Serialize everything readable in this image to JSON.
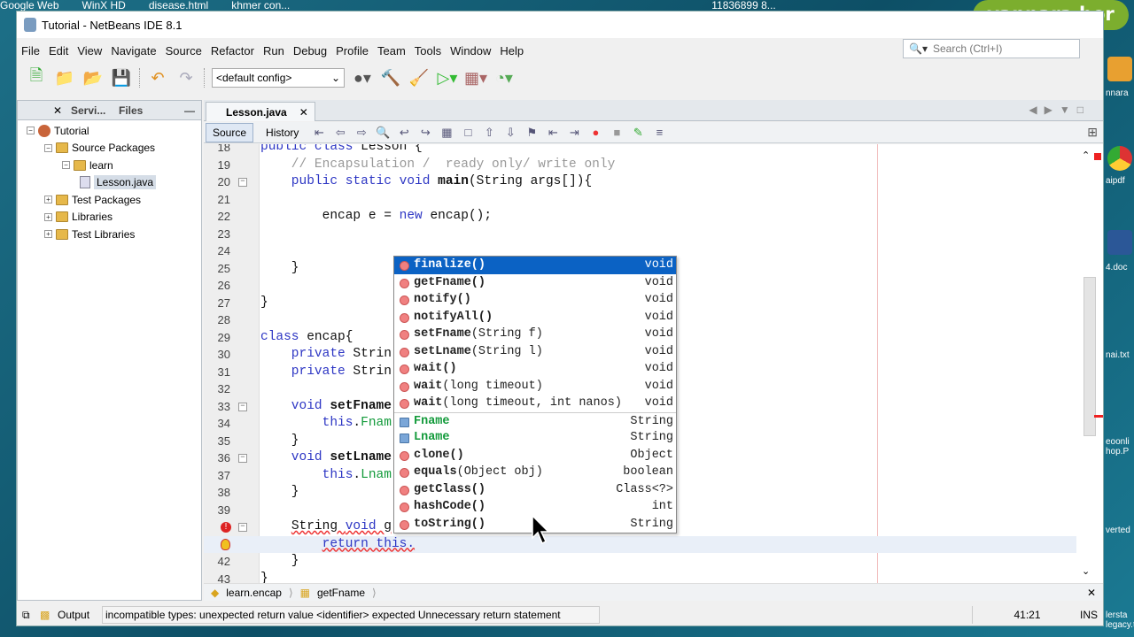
{
  "desktop": {
    "top_items": [
      "Google Web",
      "WinX HD",
      "disease.html",
      "khmer con...",
      "11836899 8..."
    ],
    "right_labels": [
      "nnara",
      "aipdf",
      "4.doc",
      "nai.txt",
      "eoonli hop.P",
      "verted",
      "lersta legacy.t"
    ],
    "badge": "vannara hor"
  },
  "window": {
    "title": "Tutorial - NetBeans IDE 8.1"
  },
  "menu": [
    "File",
    "Edit",
    "View",
    "Navigate",
    "Source",
    "Refactor",
    "Run",
    "Debug",
    "Profile",
    "Team",
    "Tools",
    "Window",
    "Help"
  ],
  "search": {
    "placeholder": "Search (Ctrl+I)"
  },
  "toolbar": {
    "config": "<default config>"
  },
  "left_panel": {
    "tabs": [
      "Servi...",
      "Files"
    ],
    "tree": [
      {
        "label": "Tutorial",
        "depth": 0,
        "type": "project"
      },
      {
        "label": "Source Packages",
        "depth": 1,
        "type": "folder"
      },
      {
        "label": "learn",
        "depth": 2,
        "type": "package"
      },
      {
        "label": "Lesson.java",
        "depth": 3,
        "type": "file",
        "selected": true
      },
      {
        "label": "Test Packages",
        "depth": 1,
        "type": "folder"
      },
      {
        "label": "Libraries",
        "depth": 1,
        "type": "folder"
      },
      {
        "label": "Test Libraries",
        "depth": 1,
        "type": "folder"
      }
    ]
  },
  "editor": {
    "tab": "Lesson.java",
    "source_label": "Source",
    "history_label": "History",
    "lines": [
      {
        "n": "18",
        "t": [
          [
            "public class ",
            "kw"
          ],
          [
            "Lesson {",
            ""
          ]
        ]
      },
      {
        "n": "19",
        "t": [
          [
            "    // Encapsulation /  ready only/ write only",
            "cm"
          ]
        ]
      },
      {
        "n": "20",
        "fold": true,
        "t": [
          [
            "    public static void ",
            "kw"
          ],
          [
            "main",
            "bd"
          ],
          [
            "(String args[]){",
            ""
          ]
        ]
      },
      {
        "n": "21",
        "t": []
      },
      {
        "n": "22",
        "t": [
          [
            "        encap e = ",
            ""
          ],
          [
            "new",
            "kw"
          ],
          [
            " encap();",
            ""
          ]
        ]
      },
      {
        "n": "23",
        "t": []
      },
      {
        "n": "24",
        "t": []
      },
      {
        "n": "25",
        "t": [
          [
            "    }",
            ""
          ]
        ]
      },
      {
        "n": "26",
        "t": []
      },
      {
        "n": "27",
        "t": [
          [
            "}",
            ""
          ]
        ]
      },
      {
        "n": "28",
        "t": []
      },
      {
        "n": "29",
        "t": [
          [
            "class ",
            "kw"
          ],
          [
            "encap{",
            ""
          ]
        ]
      },
      {
        "n": "30",
        "t": [
          [
            "    private ",
            "kw"
          ],
          [
            "Strin",
            ""
          ]
        ]
      },
      {
        "n": "31",
        "t": [
          [
            "    private ",
            "kw"
          ],
          [
            "Strin",
            ""
          ]
        ]
      },
      {
        "n": "32",
        "t": []
      },
      {
        "n": "33",
        "fold": true,
        "t": [
          [
            "    void ",
            "kw"
          ],
          [
            "setFname",
            "bd"
          ]
        ]
      },
      {
        "n": "34",
        "t": [
          [
            "        this",
            "kw"
          ],
          [
            ".",
            ""
          ],
          [
            "Fnam",
            "fld"
          ]
        ]
      },
      {
        "n": "35",
        "t": [
          [
            "    }",
            ""
          ]
        ]
      },
      {
        "n": "36",
        "fold": true,
        "t": [
          [
            "    void ",
            "kw"
          ],
          [
            "setLname",
            "bd"
          ]
        ]
      },
      {
        "n": "37",
        "t": [
          [
            "        this",
            "kw"
          ],
          [
            ".",
            ""
          ],
          [
            "Lnam",
            "fld"
          ]
        ]
      },
      {
        "n": "38",
        "t": [
          [
            "    }",
            ""
          ]
        ]
      },
      {
        "n": "39",
        "t": []
      },
      {
        "n": "",
        "icon": "error",
        "fold": true,
        "t": [
          [
            "    ",
            ""
          ],
          [
            "String ",
            "err"
          ],
          [
            "void",
            "kw err"
          ],
          [
            " g",
            "err"
          ]
        ]
      },
      {
        "n": "",
        "icon": "bulb",
        "current": true,
        "t": [
          [
            "        ",
            ""
          ],
          [
            "return this.",
            "kw err"
          ]
        ]
      },
      {
        "n": "42",
        "t": [
          [
            "    }",
            ""
          ]
        ]
      },
      {
        "n": "43",
        "t": [
          [
            "}",
            ""
          ]
        ]
      }
    ]
  },
  "completion": [
    {
      "name": "finalize()",
      "type": "void",
      "icon": "method",
      "selected": true
    },
    {
      "name": "getFname()",
      "type": "void",
      "icon": "method"
    },
    {
      "name": "notify()",
      "type": "void",
      "icon": "method"
    },
    {
      "name": "notifyAll()",
      "type": "void",
      "icon": "method"
    },
    {
      "name": "setFname",
      "params": "(String f)",
      "type": "void",
      "icon": "method"
    },
    {
      "name": "setLname",
      "params": "(String l)",
      "type": "void",
      "icon": "method"
    },
    {
      "name": "wait()",
      "type": "void",
      "icon": "method"
    },
    {
      "name": "wait",
      "params": "(long timeout)",
      "type": "void",
      "icon": "method"
    },
    {
      "name": "wait",
      "params": "(long timeout, int nanos)",
      "type": "void",
      "icon": "method"
    },
    {
      "name": "Fname",
      "type": "String",
      "icon": "field",
      "group": true
    },
    {
      "name": "Lname",
      "type": "String",
      "icon": "field"
    },
    {
      "name": "clone()",
      "type": "Object",
      "icon": "method"
    },
    {
      "name": "equals",
      "params": "(Object obj)",
      "type": "boolean",
      "icon": "method"
    },
    {
      "name": "getClass()",
      "type": "Class<?>",
      "icon": "method"
    },
    {
      "name": "hashCode()",
      "type": "int",
      "icon": "method"
    },
    {
      "name": "toString()",
      "type": "String",
      "icon": "method"
    }
  ],
  "breadcrumb": [
    "learn.encap",
    "getFname"
  ],
  "status": {
    "output_label": "Output",
    "message": "incompatible types: unexpected return value  <identifier> expected  Unnecessary return statement",
    "position": "41:21",
    "mode": "INS"
  }
}
